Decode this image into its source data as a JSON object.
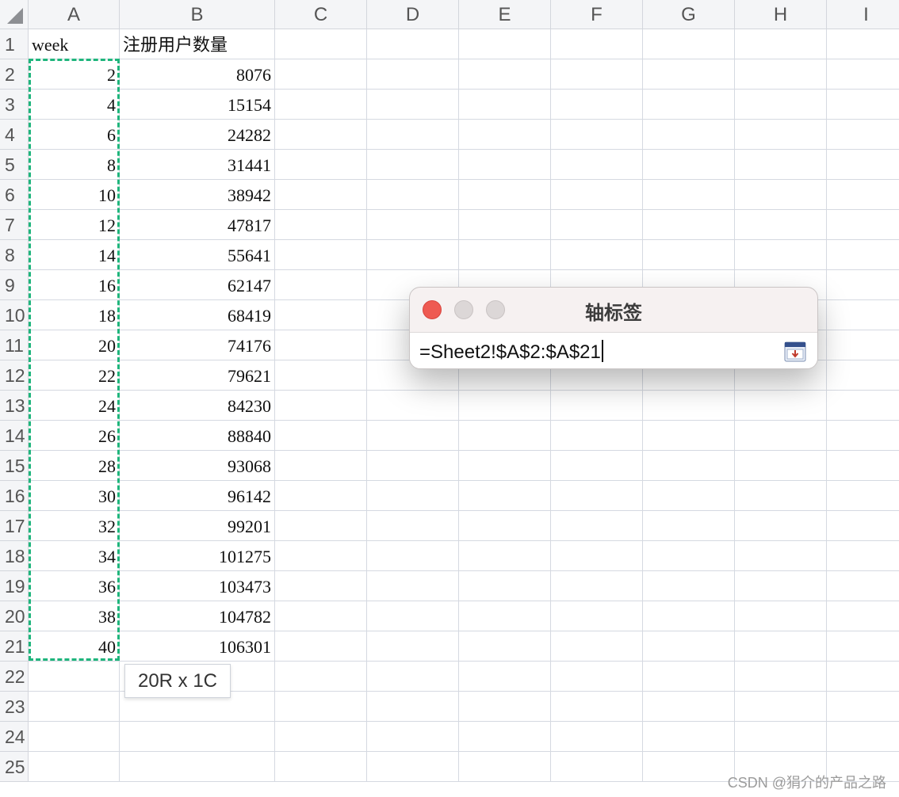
{
  "spreadsheet": {
    "columns": [
      "A",
      "B",
      "C",
      "D",
      "E",
      "F",
      "G",
      "H",
      "I"
    ],
    "row_numbers": [
      "1",
      "2",
      "3",
      "4",
      "5",
      "6",
      "7",
      "8",
      "9",
      "10",
      "11",
      "12",
      "13",
      "14",
      "15",
      "16",
      "17",
      "18",
      "19",
      "20",
      "21",
      "22",
      "23",
      "24",
      "25"
    ],
    "headers": {
      "col_a": "week",
      "col_b": "注册用户数量"
    },
    "rows": [
      {
        "week": "2",
        "users": "8076"
      },
      {
        "week": "4",
        "users": "15154"
      },
      {
        "week": "6",
        "users": "24282"
      },
      {
        "week": "8",
        "users": "31441"
      },
      {
        "week": "10",
        "users": "38942"
      },
      {
        "week": "12",
        "users": "47817"
      },
      {
        "week": "14",
        "users": "55641"
      },
      {
        "week": "16",
        "users": "62147"
      },
      {
        "week": "18",
        "users": "68419"
      },
      {
        "week": "20",
        "users": "74176"
      },
      {
        "week": "22",
        "users": "79621"
      },
      {
        "week": "24",
        "users": "84230"
      },
      {
        "week": "26",
        "users": "88840"
      },
      {
        "week": "28",
        "users": "93068"
      },
      {
        "week": "30",
        "users": "96142"
      },
      {
        "week": "32",
        "users": "99201"
      },
      {
        "week": "34",
        "users": "101275"
      },
      {
        "week": "36",
        "users": "103473"
      },
      {
        "week": "38",
        "users": "104782"
      },
      {
        "week": "40",
        "users": "106301"
      }
    ],
    "selection_size_tip": "20R x 1C",
    "copy_range_color": "#1fb57c"
  },
  "dialog": {
    "title": "轴标签",
    "range_value": "=Sheet2!$A$2:$A$21",
    "collapse_icon": "range-picker-icon",
    "close_color": "#ee5a52"
  },
  "watermark": "CSDN @狷介的产品之路"
}
